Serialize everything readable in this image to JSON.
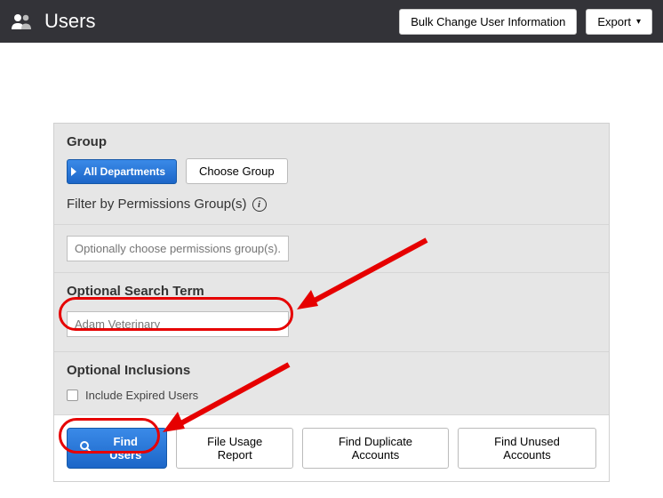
{
  "header": {
    "title": "Users",
    "bulk_button": "Bulk Change User Information",
    "export_button": "Export"
  },
  "group": {
    "section_title": "Group",
    "all_departments": "All Departments",
    "choose_group": "Choose Group",
    "filter_label": "Filter by Permissions Group(s)",
    "permissions_placeholder": "Optionally choose permissions group(s)..."
  },
  "search": {
    "section_title": "Optional Search Term",
    "value": "Adam Veterinary"
  },
  "inclusions": {
    "section_title": "Optional Inclusions",
    "include_expired": "Include Expired Users"
  },
  "actions": {
    "find_users": "Find Users",
    "file_usage": "File Usage Report",
    "find_duplicate": "Find Duplicate Accounts",
    "find_unused": "Find Unused Accounts"
  }
}
